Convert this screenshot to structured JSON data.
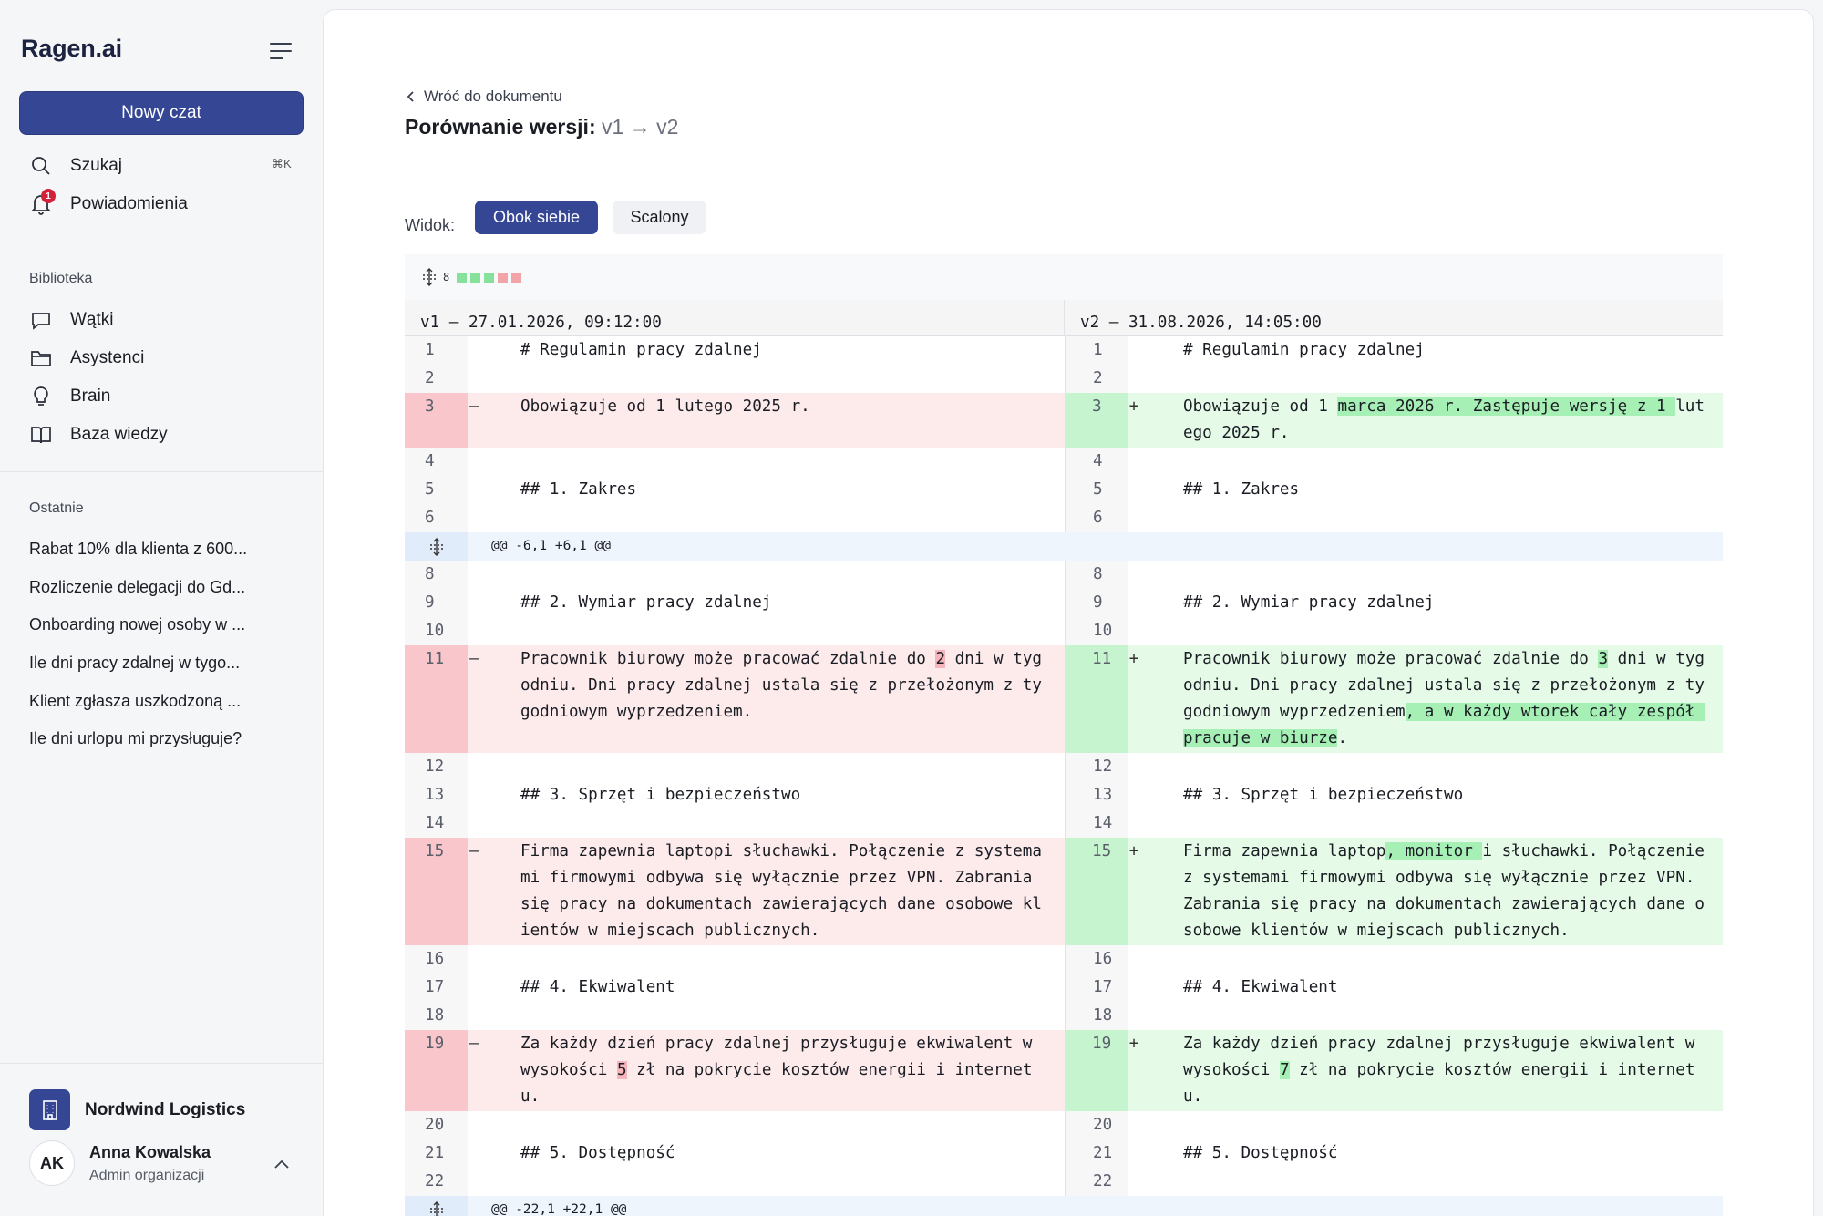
{
  "sidebar": {
    "logo": "Ragen.ai",
    "new_chat": "Nowy czat",
    "search_label": "Szukaj",
    "search_shortcut": "⌘K",
    "notifications_label": "Powiadomienia",
    "notifications_count": "1",
    "library_title": "Biblioteka",
    "library_items": [
      "Wątki",
      "Asystenci",
      "Brain",
      "Baza wiedzy"
    ],
    "recent_title": "Ostatnie",
    "recent_items": [
      "Rabat 10% dla klienta z 600...",
      "Rozliczenie delegacji do Gd...",
      "Onboarding nowej osoby w ...",
      "Ile dni pracy zdalnej w tygo...",
      "Klient zgłasza uszkodzoną ...",
      "Ile dni urlopu mi przysługuje?"
    ],
    "org_name": "Nordwind Logistics",
    "user_initials": "AK",
    "user_name": "Anna Kowalska",
    "user_role": "Admin organizacji"
  },
  "main": {
    "back_label": "Wróć do dokumentu",
    "title_prefix": "Porównanie wersji:",
    "title_versions": "v1 → v2",
    "view_label": "Widok:",
    "view_side": "Obok siebie",
    "view_merged": "Scalony",
    "diff_changes": "8",
    "left_header": "v1 — 27.01.2026, 09:12:00",
    "right_header": "v2 — 31.08.2026, 14:05:00",
    "hunk1": "@@ -6,1 +6,1 @@",
    "hunk2": "@@ -22,1 +22,1 @@"
  },
  "colors": {
    "accent": "#354694",
    "deleted": "#fdebec",
    "added": "#e5fbe8",
    "badge": "#d3213b"
  }
}
